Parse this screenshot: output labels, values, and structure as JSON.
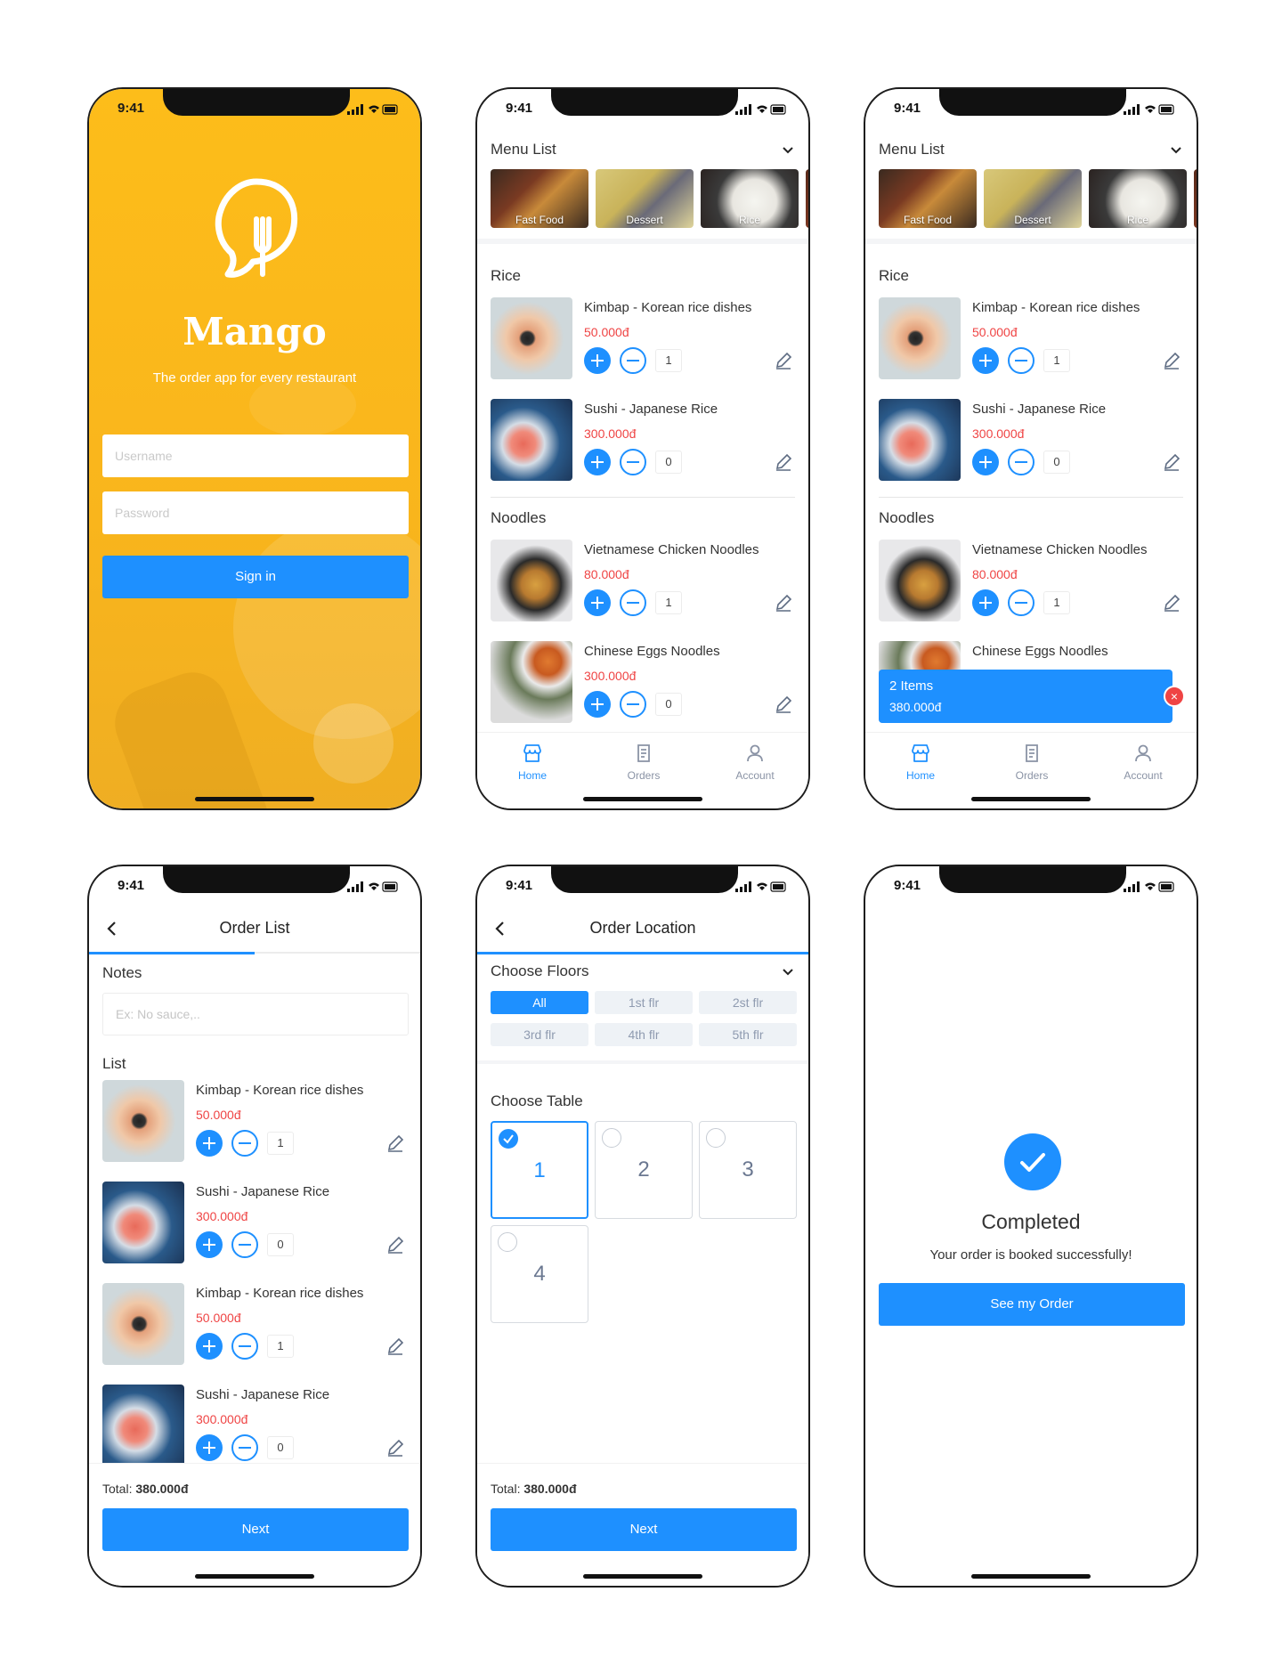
{
  "status": {
    "time": "9:41"
  },
  "login": {
    "brand": "Mango",
    "tagline": "The order app for every restaurant",
    "username_placeholder": "Username",
    "password_placeholder": "Password",
    "sign_in": "Sign in",
    "accent": "#fdbd1a"
  },
  "menu": {
    "title": "Menu List",
    "categories": [
      "Fast Food",
      "Dessert",
      "Rice"
    ],
    "sections": [
      {
        "title": "Rice",
        "items": [
          {
            "name": "Kimbap - Korean rice dishes",
            "price": "50.000đ",
            "qty": "1"
          },
          {
            "name": "Sushi - Japanese Rice",
            "price": "300.000đ",
            "qty": "0"
          }
        ]
      },
      {
        "title": "Noodles",
        "items": [
          {
            "name": "Vietnamese Chicken Noodles",
            "price": "80.000đ",
            "qty": "1"
          },
          {
            "name": "Chinese Eggs Noodles",
            "price": "300.000đ",
            "qty": "0"
          }
        ]
      }
    ],
    "tabs": [
      "Home",
      "Orders",
      "Account"
    ],
    "cart": {
      "count": "2 Items",
      "total": "380.000đ",
      "close": "×"
    }
  },
  "order_list": {
    "title": "Order List",
    "notes_label": "Notes",
    "notes_placeholder": "Ex: No sauce,..",
    "list_label": "List",
    "items": [
      {
        "name": "Kimbap - Korean rice dishes",
        "price": "50.000đ",
        "qty": "1"
      },
      {
        "name": "Sushi - Japanese Rice",
        "price": "300.000đ",
        "qty": "0"
      },
      {
        "name": "Kimbap - Korean rice dishes",
        "price": "50.000đ",
        "qty": "1"
      },
      {
        "name": "Sushi - Japanese Rice",
        "price": "300.000đ",
        "qty": "0"
      }
    ],
    "total_label": "Total:",
    "total_value": "380.000đ",
    "next": "Next"
  },
  "order_location": {
    "title": "Order Location",
    "floors_label": "Choose Floors",
    "floors": [
      "All",
      "1st flr",
      "2st flr",
      "3rd flr",
      "4th flr",
      "5th flr"
    ],
    "selected_floor": "All",
    "table_label": "Choose Table",
    "tables": [
      "1",
      "2",
      "3",
      "4"
    ],
    "selected_table": "1",
    "total_label": "Total:",
    "total_value": "380.000đ",
    "next": "Next"
  },
  "completed": {
    "title": "Completed",
    "message": "Your order is booked successfully!",
    "button": "See my Order"
  },
  "colors": {
    "primary": "#1e90ff",
    "price": "#ef4444",
    "inactive": "#8a93a5"
  }
}
